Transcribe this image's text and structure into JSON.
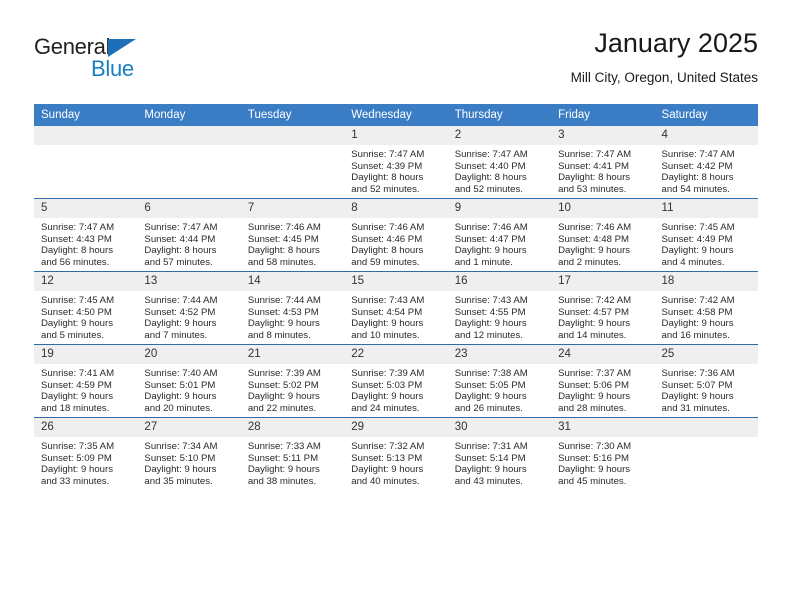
{
  "brand": {
    "name_top": "General",
    "name_bottom": "Blue",
    "triangle_icon": "triangle-icon",
    "color_dark": "#231f20",
    "color_blue": "#1a7fc1"
  },
  "header": {
    "title": "January 2025",
    "subtitle": "Mill City, Oregon, United States"
  },
  "theme": {
    "header_bg": "#3b7dc4",
    "row_divider": "#2d6ca8",
    "daynum_bg": "#efefef",
    "text": "#2a2a2a"
  },
  "calendar": {
    "weekday_headers": [
      "Sunday",
      "Monday",
      "Tuesday",
      "Wednesday",
      "Thursday",
      "Friday",
      "Saturday"
    ],
    "weeks": [
      [
        {
          "day": "",
          "empty": true
        },
        {
          "day": "",
          "empty": true
        },
        {
          "day": "",
          "empty": true
        },
        {
          "day": "1",
          "sunrise": "Sunrise: 7:47 AM",
          "sunset": "Sunset: 4:39 PM",
          "daylight": "Daylight: 8 hours and 52 minutes."
        },
        {
          "day": "2",
          "sunrise": "Sunrise: 7:47 AM",
          "sunset": "Sunset: 4:40 PM",
          "daylight": "Daylight: 8 hours and 52 minutes."
        },
        {
          "day": "3",
          "sunrise": "Sunrise: 7:47 AM",
          "sunset": "Sunset: 4:41 PM",
          "daylight": "Daylight: 8 hours and 53 minutes."
        },
        {
          "day": "4",
          "sunrise": "Sunrise: 7:47 AM",
          "sunset": "Sunset: 4:42 PM",
          "daylight": "Daylight: 8 hours and 54 minutes."
        }
      ],
      [
        {
          "day": "5",
          "sunrise": "Sunrise: 7:47 AM",
          "sunset": "Sunset: 4:43 PM",
          "daylight": "Daylight: 8 hours and 56 minutes."
        },
        {
          "day": "6",
          "sunrise": "Sunrise: 7:47 AM",
          "sunset": "Sunset: 4:44 PM",
          "daylight": "Daylight: 8 hours and 57 minutes."
        },
        {
          "day": "7",
          "sunrise": "Sunrise: 7:46 AM",
          "sunset": "Sunset: 4:45 PM",
          "daylight": "Daylight: 8 hours and 58 minutes."
        },
        {
          "day": "8",
          "sunrise": "Sunrise: 7:46 AM",
          "sunset": "Sunset: 4:46 PM",
          "daylight": "Daylight: 8 hours and 59 minutes."
        },
        {
          "day": "9",
          "sunrise": "Sunrise: 7:46 AM",
          "sunset": "Sunset: 4:47 PM",
          "daylight": "Daylight: 9 hours and 1 minute."
        },
        {
          "day": "10",
          "sunrise": "Sunrise: 7:46 AM",
          "sunset": "Sunset: 4:48 PM",
          "daylight": "Daylight: 9 hours and 2 minutes."
        },
        {
          "day": "11",
          "sunrise": "Sunrise: 7:45 AM",
          "sunset": "Sunset: 4:49 PM",
          "daylight": "Daylight: 9 hours and 4 minutes."
        }
      ],
      [
        {
          "day": "12",
          "sunrise": "Sunrise: 7:45 AM",
          "sunset": "Sunset: 4:50 PM",
          "daylight": "Daylight: 9 hours and 5 minutes."
        },
        {
          "day": "13",
          "sunrise": "Sunrise: 7:44 AM",
          "sunset": "Sunset: 4:52 PM",
          "daylight": "Daylight: 9 hours and 7 minutes."
        },
        {
          "day": "14",
          "sunrise": "Sunrise: 7:44 AM",
          "sunset": "Sunset: 4:53 PM",
          "daylight": "Daylight: 9 hours and 8 minutes."
        },
        {
          "day": "15",
          "sunrise": "Sunrise: 7:43 AM",
          "sunset": "Sunset: 4:54 PM",
          "daylight": "Daylight: 9 hours and 10 minutes."
        },
        {
          "day": "16",
          "sunrise": "Sunrise: 7:43 AM",
          "sunset": "Sunset: 4:55 PM",
          "daylight": "Daylight: 9 hours and 12 minutes."
        },
        {
          "day": "17",
          "sunrise": "Sunrise: 7:42 AM",
          "sunset": "Sunset: 4:57 PM",
          "daylight": "Daylight: 9 hours and 14 minutes."
        },
        {
          "day": "18",
          "sunrise": "Sunrise: 7:42 AM",
          "sunset": "Sunset: 4:58 PM",
          "daylight": "Daylight: 9 hours and 16 minutes."
        }
      ],
      [
        {
          "day": "19",
          "sunrise": "Sunrise: 7:41 AM",
          "sunset": "Sunset: 4:59 PM",
          "daylight": "Daylight: 9 hours and 18 minutes."
        },
        {
          "day": "20",
          "sunrise": "Sunrise: 7:40 AM",
          "sunset": "Sunset: 5:01 PM",
          "daylight": "Daylight: 9 hours and 20 minutes."
        },
        {
          "day": "21",
          "sunrise": "Sunrise: 7:39 AM",
          "sunset": "Sunset: 5:02 PM",
          "daylight": "Daylight: 9 hours and 22 minutes."
        },
        {
          "day": "22",
          "sunrise": "Sunrise: 7:39 AM",
          "sunset": "Sunset: 5:03 PM",
          "daylight": "Daylight: 9 hours and 24 minutes."
        },
        {
          "day": "23",
          "sunrise": "Sunrise: 7:38 AM",
          "sunset": "Sunset: 5:05 PM",
          "daylight": "Daylight: 9 hours and 26 minutes."
        },
        {
          "day": "24",
          "sunrise": "Sunrise: 7:37 AM",
          "sunset": "Sunset: 5:06 PM",
          "daylight": "Daylight: 9 hours and 28 minutes."
        },
        {
          "day": "25",
          "sunrise": "Sunrise: 7:36 AM",
          "sunset": "Sunset: 5:07 PM",
          "daylight": "Daylight: 9 hours and 31 minutes."
        }
      ],
      [
        {
          "day": "26",
          "sunrise": "Sunrise: 7:35 AM",
          "sunset": "Sunset: 5:09 PM",
          "daylight": "Daylight: 9 hours and 33 minutes."
        },
        {
          "day": "27",
          "sunrise": "Sunrise: 7:34 AM",
          "sunset": "Sunset: 5:10 PM",
          "daylight": "Daylight: 9 hours and 35 minutes."
        },
        {
          "day": "28",
          "sunrise": "Sunrise: 7:33 AM",
          "sunset": "Sunset: 5:11 PM",
          "daylight": "Daylight: 9 hours and 38 minutes."
        },
        {
          "day": "29",
          "sunrise": "Sunrise: 7:32 AM",
          "sunset": "Sunset: 5:13 PM",
          "daylight": "Daylight: 9 hours and 40 minutes."
        },
        {
          "day": "30",
          "sunrise": "Sunrise: 7:31 AM",
          "sunset": "Sunset: 5:14 PM",
          "daylight": "Daylight: 9 hours and 43 minutes."
        },
        {
          "day": "31",
          "sunrise": "Sunrise: 7:30 AM",
          "sunset": "Sunset: 5:16 PM",
          "daylight": "Daylight: 9 hours and 45 minutes."
        },
        {
          "day": "",
          "empty": true
        }
      ]
    ]
  }
}
